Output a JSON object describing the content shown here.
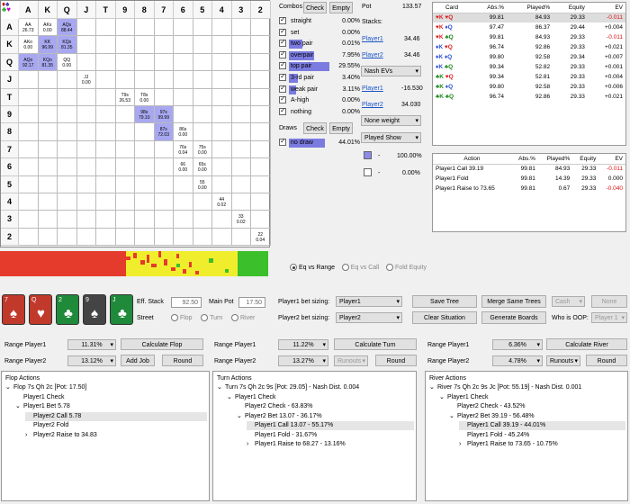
{
  "grid": {
    "header": [
      "A",
      "K",
      "Q",
      "J",
      "T",
      "9",
      "8",
      "7",
      "6",
      "5",
      "4",
      "3",
      "2"
    ],
    "cells": [
      {
        "r": 0,
        "c": 0,
        "t": "AA",
        "v": "26.73",
        "cls": ""
      },
      {
        "r": 0,
        "c": 1,
        "t": "AKs",
        "v": "0.00",
        "cls": ""
      },
      {
        "r": 0,
        "c": 2,
        "t": "AQs",
        "v": "88.44",
        "cls": "hl"
      },
      {
        "r": 1,
        "c": 0,
        "t": "AKo",
        "v": "0.00",
        "cls": ""
      },
      {
        "r": 1,
        "c": 1,
        "t": "KK",
        "v": "96.99",
        "cls": "hl"
      },
      {
        "r": 1,
        "c": 2,
        "t": "KQs",
        "v": "81.35",
        "cls": "hl"
      },
      {
        "r": 2,
        "c": 0,
        "t": "AQo",
        "v": "92.17",
        "cls": "hl"
      },
      {
        "r": 2,
        "c": 1,
        "t": "KQo",
        "v": "81.35",
        "cls": "hl"
      },
      {
        "r": 2,
        "c": 2,
        "t": "QQ",
        "v": "0.00",
        "cls": ""
      },
      {
        "r": 3,
        "c": 3,
        "t": "JJ",
        "v": "0.00",
        "cls": ""
      },
      {
        "r": 4,
        "c": 5,
        "t": "T9s",
        "v": "26.53",
        "cls": ""
      },
      {
        "r": 4,
        "c": 6,
        "t": "T8s",
        "v": "0.00",
        "cls": ""
      },
      {
        "r": 5,
        "c": 6,
        "t": "98s",
        "v": "79.10",
        "cls": "hl"
      },
      {
        "r": 5,
        "c": 7,
        "t": "97s",
        "v": "99.99",
        "cls": "hl"
      },
      {
        "r": 6,
        "c": 7,
        "t": "87s",
        "v": "72.03",
        "cls": "hl"
      },
      {
        "r": 6,
        "c": 8,
        "t": "86s",
        "v": "0.00",
        "cls": ""
      },
      {
        "r": 7,
        "c": 8,
        "t": "76s",
        "v": "0.04",
        "cls": ""
      },
      {
        "r": 7,
        "c": 9,
        "t": "75s",
        "v": "0.00",
        "cls": ""
      },
      {
        "r": 8,
        "c": 8,
        "t": "66",
        "v": "0.00",
        "cls": ""
      },
      {
        "r": 8,
        "c": 9,
        "t": "65s",
        "v": "0.00",
        "cls": ""
      },
      {
        "r": 9,
        "c": 9,
        "t": "55",
        "v": "0.00",
        "cls": ""
      },
      {
        "r": 10,
        "c": 10,
        "t": "44",
        "v": "0.02",
        "cls": ""
      },
      {
        "r": 11,
        "c": 11,
        "t": "33",
        "v": "0.02",
        "cls": ""
      },
      {
        "r": 12,
        "c": 12,
        "t": "22",
        "v": "0.04",
        "cls": ""
      }
    ]
  },
  "combos": {
    "label": "Combos",
    "check": "Check",
    "empty": "Empty",
    "items": [
      {
        "name": "straight",
        "val": "0.00%",
        "pct": 0,
        "on": true
      },
      {
        "name": "set",
        "val": "0.00%",
        "pct": 0,
        "on": true
      },
      {
        "name": "two pair",
        "val": "0.01%",
        "pct": 0.3,
        "on": true
      },
      {
        "name": "overpair",
        "val": "7.95%",
        "pct": 0.55,
        "on": true
      },
      {
        "name": "top pair",
        "val": "29.55%",
        "pct": 0.9,
        "on": true
      },
      {
        "name": "3-rd pair",
        "val": "3.40%",
        "pct": 0.2,
        "on": true
      },
      {
        "name": "weak pair",
        "val": "3.11%",
        "pct": 0.15,
        "on": true
      },
      {
        "name": "A-high",
        "val": "0.00%",
        "pct": 0,
        "on": true
      },
      {
        "name": "nothing",
        "val": "0.00%",
        "pct": 0,
        "on": true
      }
    ]
  },
  "draws": {
    "label": "Draws",
    "check": "Check",
    "empty": "Empty",
    "item": "no draw",
    "val": "44.01%"
  },
  "pot": {
    "label": "Pot",
    "value": "133.57",
    "stacks": "Stacks:",
    "p1": "Player1",
    "p1v": "34.46",
    "p2": "Player2",
    "p2v": "34.46",
    "ev_mode": "Nash EVs",
    "ev_p1": "Player1",
    "ev_p1v": "-16.530",
    "ev_p2": "Player2",
    "ev_p2v": "34.030",
    "weight": "None weight",
    "show": "Played Show",
    "leg1": "-",
    "leg1v": "100.00%",
    "leg2": "-",
    "leg2v": "0.00%"
  },
  "cards_table": {
    "cols": [
      "Card",
      "Abs.%",
      "Played%",
      "Equity",
      "EV"
    ],
    "rows": [
      {
        "card": "♥K ♥Q",
        "suits": [
          "#d22",
          "#d22"
        ],
        "abs": "99.81",
        "pl": "84.93",
        "eq": "29.33",
        "ev": "-0.011",
        "neg": true
      },
      {
        "card": "♥K ♦Q",
        "suits": [
          "#d22",
          "#2a4ed8"
        ],
        "abs": "97.47",
        "pl": "86.37",
        "eq": "29.44",
        "ev": "+0.004",
        "neg": false
      },
      {
        "card": "♥K ♣Q",
        "suits": [
          "#d22",
          "#1a8a1a"
        ],
        "abs": "99.81",
        "pl": "84.93",
        "eq": "29.33",
        "ev": "-0.011",
        "neg": true
      },
      {
        "card": "♦K ♥Q",
        "suits": [
          "#2a4ed8",
          "#d22"
        ],
        "abs": "96.74",
        "pl": "92.86",
        "eq": "29.33",
        "ev": "+0.021",
        "neg": false
      },
      {
        "card": "♦K ♦Q",
        "suits": [
          "#2a4ed8",
          "#2a4ed8"
        ],
        "abs": "99.80",
        "pl": "92.58",
        "eq": "29.34",
        "ev": "+0.007",
        "neg": false
      },
      {
        "card": "♦K ♣Q",
        "suits": [
          "#2a4ed8",
          "#1a8a1a"
        ],
        "abs": "99.34",
        "pl": "52.82",
        "eq": "29.33",
        "ev": "+0.001",
        "neg": false
      },
      {
        "card": "♣K ♥Q",
        "suits": [
          "#1a8a1a",
          "#d22"
        ],
        "abs": "99.34",
        "pl": "52.81",
        "eq": "29.33",
        "ev": "+0.004",
        "neg": false
      },
      {
        "card": "♣K ♦Q",
        "suits": [
          "#1a8a1a",
          "#2a4ed8"
        ],
        "abs": "99.80",
        "pl": "92.58",
        "eq": "29.33",
        "ev": "+0.006",
        "neg": false
      },
      {
        "card": "♣K ♣Q",
        "suits": [
          "#1a8a1a",
          "#1a8a1a"
        ],
        "abs": "96.74",
        "pl": "92.86",
        "eq": "29.33",
        "ev": "+0.021",
        "neg": false
      }
    ]
  },
  "action_table": {
    "cols": [
      "Action",
      "Abs.%",
      "Played%",
      "Equity",
      "EV"
    ],
    "rows": [
      {
        "a": "Player1 Call 39.19",
        "abs": "99.81",
        "pl": "84.93",
        "eq": "29.33",
        "ev": "-0.011"
      },
      {
        "a": "Player1 Fold",
        "abs": "99.81",
        "pl": "14.39",
        "eq": "29.33",
        "ev": "0.000"
      },
      {
        "a": "Player1 Raise to 73.65",
        "abs": "99.81",
        "pl": "0.67",
        "eq": "29.33",
        "ev": "-0.040"
      }
    ]
  },
  "eq_radio": {
    "opt1": "Eq vs Range",
    "opt2": "Eq vs Call",
    "opt3": "Fold Equity"
  },
  "board": [
    {
      "rank": "7",
      "suit": "♠",
      "color": "#c0392b"
    },
    {
      "rank": "Q",
      "suit": "♥",
      "color": "#c0392b"
    },
    {
      "rank": "2",
      "suit": "♣",
      "color": "#1e8a3a"
    },
    {
      "rank": "9",
      "suit": "♠",
      "color": "#444"
    },
    {
      "rank": "J",
      "suit": "♣",
      "color": "#1e8a3a"
    }
  ],
  "mid": {
    "eff_stack": "Eff. Stack",
    "eff_val": "92.50",
    "main_pot": "Main Pot",
    "main_val": "17.50",
    "street": "Street",
    "flop": "Flop",
    "turn": "Turn",
    "river": "River",
    "p1_sizing": "Player1 bet sizing:",
    "p1_sel": "Player1",
    "p2_sizing": "Player2 bet sizing:",
    "p2_sel": "Player2",
    "save_tree": "Save Tree",
    "clear_situation": "Clear Situation",
    "merge": "Merge Same Trees",
    "gen_boards": "Generate Boards",
    "cash": "Cash",
    "none": "None",
    "who_oop": "Who is OOP:",
    "oop_sel": "Player 1"
  },
  "ranges": {
    "flop": {
      "r1": "Range Player1",
      "r1v": "11.31%",
      "calc": "Calculate Flop",
      "r2": "Range Player2",
      "r2v": "13.12%",
      "add": "Add Job",
      "round": "Round"
    },
    "turn": {
      "r1": "Range Player1",
      "r1v": "11.22%",
      "calc": "Calculate Turn",
      "r2": "Range Player2",
      "r2v": "13.27%",
      "runouts": "Runouts",
      "round": "Round"
    },
    "river": {
      "r1": "Range Player1",
      "r1v": "6.36%",
      "calc": "Calculate River",
      "r2": "Range Player2",
      "r2v": "4.78%",
      "runouts": "Runouts",
      "round": "Round"
    }
  },
  "trees": {
    "flop": {
      "title": "Flop Actions",
      "nodes": [
        {
          "t": "Flop 7s Qh 2c [Pot: 17.50]",
          "d": 0,
          "arrow": "⌄",
          "sel": false
        },
        {
          "t": "Player1 Check",
          "d": 1,
          "arrow": "",
          "sel": false
        },
        {
          "t": "Player1 Bet 5.78",
          "d": 1,
          "arrow": "⌄",
          "sel": false
        },
        {
          "t": "Player2 Call 5.78",
          "d": 2,
          "arrow": "",
          "sel": true
        },
        {
          "t": "Player2 Fold",
          "d": 2,
          "arrow": "",
          "sel": false
        },
        {
          "t": "Player2 Raise to 34.83",
          "d": 2,
          "arrow": "›",
          "sel": false
        }
      ]
    },
    "turn": {
      "title": "Turn Actions",
      "nodes": [
        {
          "t": "Turn 7s Qh 2c 9s [Pot: 29.05] - Nash Dist. 0.004",
          "d": 0,
          "arrow": "⌄",
          "sel": false
        },
        {
          "t": "Player1 Check",
          "d": 1,
          "arrow": "⌄",
          "sel": false
        },
        {
          "t": "Player2 Check - 63.83%",
          "d": 2,
          "arrow": "",
          "sel": false
        },
        {
          "t": "Player2 Bet 13.07 - 36.17%",
          "d": 2,
          "arrow": "⌄",
          "sel": false
        },
        {
          "t": "Player1 Call 13.07 - 55.17%",
          "d": 3,
          "arrow": "",
          "sel": true
        },
        {
          "t": "Player1 Fold - 31.67%",
          "d": 3,
          "arrow": "",
          "sel": false
        },
        {
          "t": "Player1 Raise to 68.27 - 13.16%",
          "d": 3,
          "arrow": "›",
          "sel": false
        }
      ]
    },
    "river": {
      "title": "River Actions",
      "nodes": [
        {
          "t": "River 7s Qh 2c 9s Jc [Pot: 55.19] - Nash Dist. 0.001",
          "d": 0,
          "arrow": "⌄",
          "sel": false
        },
        {
          "t": "Player1 Check",
          "d": 1,
          "arrow": "⌄",
          "sel": false
        },
        {
          "t": "Player2 Check - 43.52%",
          "d": 2,
          "arrow": "",
          "sel": false
        },
        {
          "t": "Player2 Bet 39.19 - 56.48%",
          "d": 2,
          "arrow": "⌄",
          "sel": false
        },
        {
          "t": "Player1 Call 39.19 - 44.01%",
          "d": 3,
          "arrow": "",
          "sel": true
        },
        {
          "t": "Player1 Fold - 45.24%",
          "d": 3,
          "arrow": "",
          "sel": false
        },
        {
          "t": "Player1 Raise to 73.65 - 10.75%",
          "d": 3,
          "arrow": "›",
          "sel": false
        }
      ]
    }
  }
}
